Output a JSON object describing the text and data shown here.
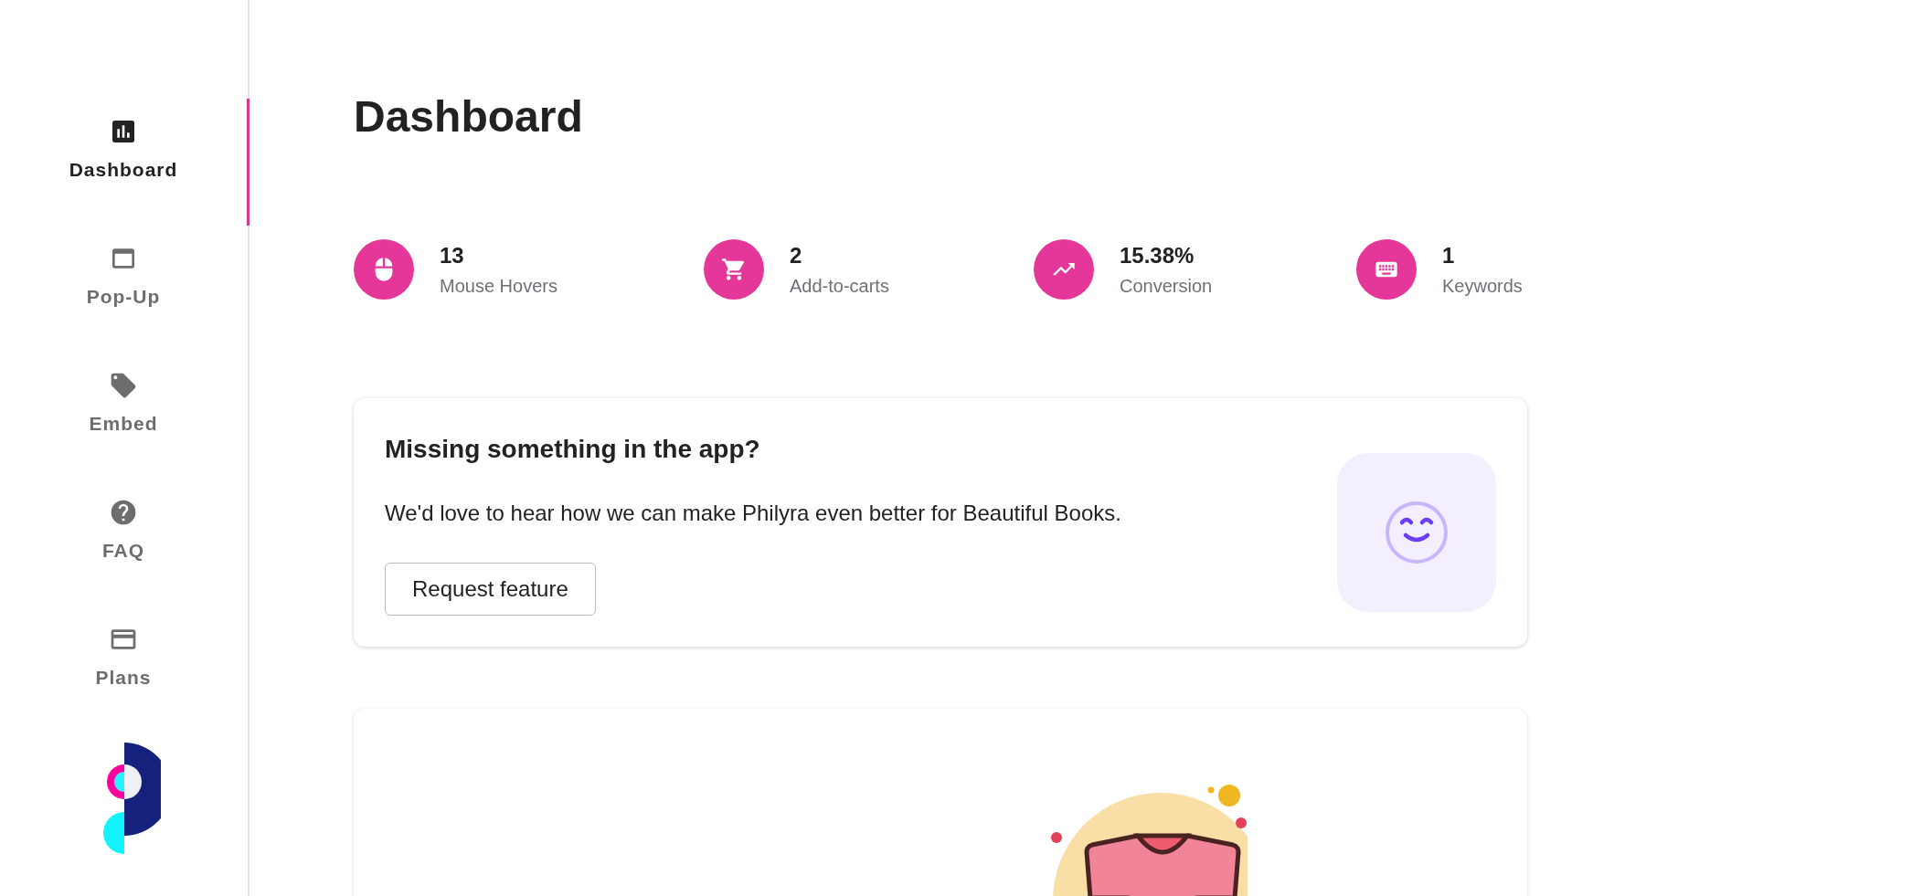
{
  "sidebar": {
    "items": [
      {
        "label": "Dashboard",
        "kind": "chart",
        "selected": true
      },
      {
        "label": "Pop-Up",
        "kind": "window",
        "selected": false
      },
      {
        "label": "Embed",
        "kind": "tag",
        "selected": false
      },
      {
        "label": "FAQ",
        "kind": "help",
        "selected": false
      },
      {
        "label": "Plans",
        "kind": "card",
        "selected": false
      }
    ]
  },
  "page": {
    "title": "Dashboard"
  },
  "stats": [
    {
      "kind": "mouse",
      "value": "13",
      "label": "Mouse Hovers"
    },
    {
      "kind": "cart",
      "value": "2",
      "label": "Add-to-carts"
    },
    {
      "kind": "trend",
      "value": "15.38%",
      "label": "Conversion"
    },
    {
      "kind": "keyboard",
      "value": "1",
      "label": "Keywords"
    }
  ],
  "feature_card": {
    "title": "Missing something in the app?",
    "text": "We'd love to hear how we can make Philyra even better for Beautiful Books.",
    "button": "Request feature"
  }
}
